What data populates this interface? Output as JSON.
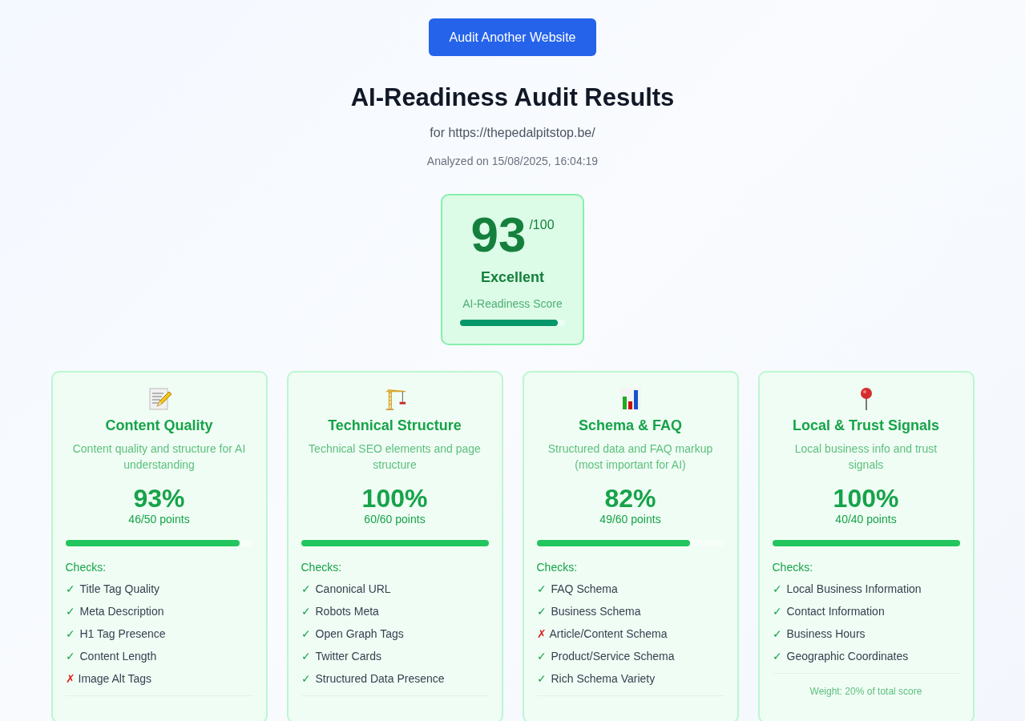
{
  "action_button": {
    "label": "Audit Another Website"
  },
  "title": "AI-Readiness Audit Results",
  "site": "for https://thepedalpitstop.be/",
  "analyzed": "Analyzed on 15/08/2025, 16:04:19",
  "score": {
    "value": "93",
    "max": "/100",
    "rating": "Excellent",
    "caption": "AI-Readiness Score",
    "level": 0.93
  },
  "categories": [
    {
      "title": "Content Quality",
      "description": "Content quality and structure for AI understanding",
      "percent": "93%",
      "points": "46/50 points",
      "level": 0.93,
      "checks_label": "Checks:",
      "checks": [
        {
          "mark": "✓",
          "label": "Title Tag Quality",
          "passed": true
        },
        {
          "mark": "✓",
          "label": "Meta Description",
          "passed": true
        },
        {
          "mark": "✓",
          "label": "H1 Tag Presence",
          "passed": true
        },
        {
          "mark": "✓",
          "label": "Content Length",
          "passed": true
        },
        {
          "mark": "✗",
          "label": "Image Alt Tags",
          "passed": false
        }
      ]
    },
    {
      "title": "Technical Structure",
      "description": "Technical SEO elements and page structure",
      "percent": "100%",
      "points": "60/60 points",
      "level": 1,
      "checks_label": "Checks:",
      "checks": [
        {
          "mark": "✓",
          "label": "Canonical URL",
          "passed": true
        },
        {
          "mark": "✓",
          "label": "Robots Meta",
          "passed": true
        },
        {
          "mark": "✓",
          "label": "Open Graph Tags",
          "passed": true
        },
        {
          "mark": "✓",
          "label": "Twitter Cards",
          "passed": true
        },
        {
          "mark": "✓",
          "label": "Structured Data Presence",
          "passed": true
        }
      ]
    },
    {
      "title": "Schema & FAQ",
      "description": "Structured data and FAQ markup (most important for AI)",
      "percent": "82%",
      "points": "49/60 points",
      "level": 0.82,
      "checks_label": "Checks:",
      "checks": [
        {
          "mark": "✓",
          "label": "FAQ Schema",
          "passed": true
        },
        {
          "mark": "✓",
          "label": "Business Schema",
          "passed": true
        },
        {
          "mark": "✗",
          "label": "Article/Content Schema",
          "passed": false
        },
        {
          "mark": "✓",
          "label": "Product/Service Schema",
          "passed": true
        },
        {
          "mark": "✓",
          "label": "Rich Schema Variety",
          "passed": true
        }
      ]
    },
    {
      "title": "Local & Trust Signals",
      "description": "Local business info and trust signals",
      "percent": "100%",
      "points": "40/40 points",
      "level": 1,
      "checks_label": "Checks:",
      "checks": [
        {
          "mark": "✓",
          "label": "Local Business Information",
          "passed": true
        },
        {
          "mark": "✓",
          "label": "Contact Information",
          "passed": true
        },
        {
          "mark": "✓",
          "label": "Business Hours",
          "passed": true
        },
        {
          "mark": "✓",
          "label": "Geographic Coordinates",
          "passed": true
        }
      ],
      "weight": "Weight: 20% of total score"
    }
  ]
}
